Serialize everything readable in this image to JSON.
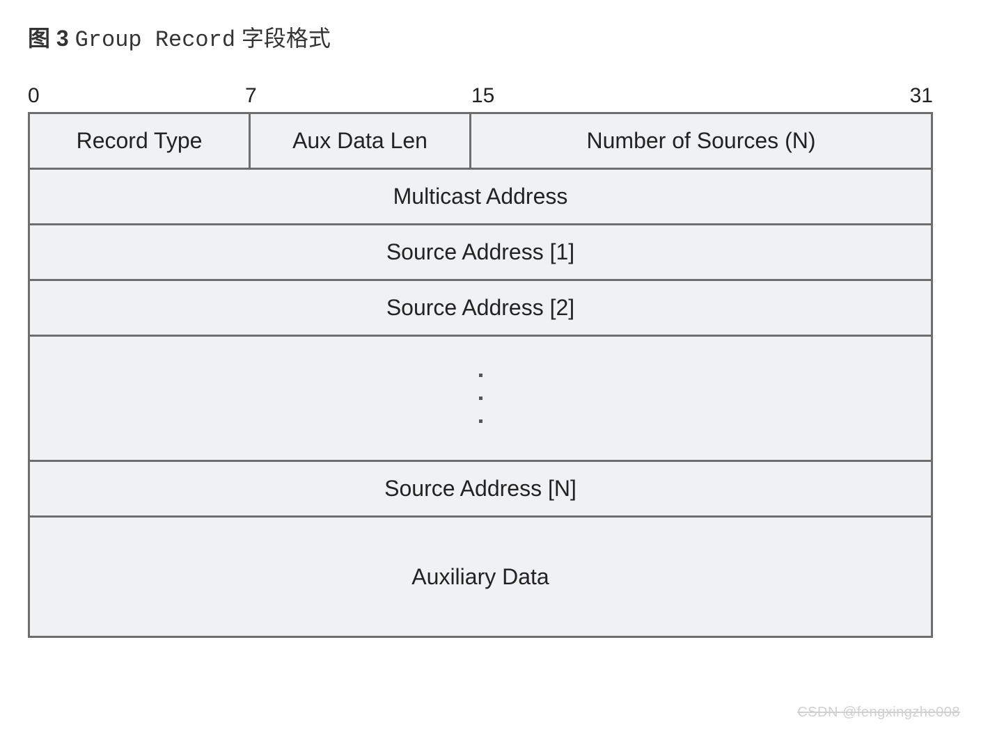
{
  "title": {
    "prefix_bold": "图 3",
    "mono": "Group Record",
    "suffix": "字段格式"
  },
  "bit_labels": {
    "b0": "0",
    "b7": "7",
    "b15": "15",
    "b31": "31"
  },
  "fields": {
    "record_type": "Record Type",
    "aux_data_len": "Aux Data Len",
    "num_sources": "Number of Sources (N)",
    "multicast_address": "Multicast Address",
    "source_address_1": "Source Address [1]",
    "source_address_2": "Source Address [2]",
    "source_address_n": "Source Address [N]",
    "auxiliary_data": "Auxiliary Data"
  },
  "watermark": "CSDN @fengxingzhe008"
}
